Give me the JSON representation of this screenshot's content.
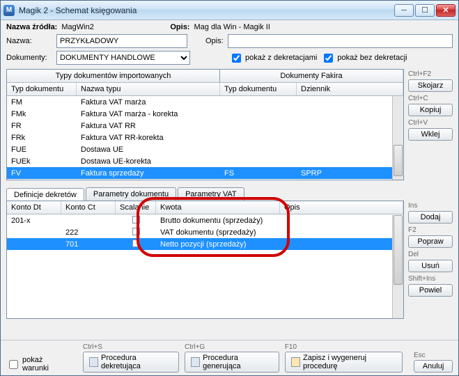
{
  "window": {
    "title": "Magik 2 - Schemat księgowania"
  },
  "header": {
    "source_label": "Nazwa źródła:",
    "source_value": "MagWin2",
    "desc_label": "Opis:",
    "desc_value": "Mag dla Win - Magik II"
  },
  "form": {
    "name_label": "Nazwa:",
    "name_value": "PRZYKŁADOWY",
    "desc_label": "Opis:",
    "desc_value": "",
    "docs_label": "Dokumenty:",
    "docs_value": "DOKUMENTY HANDLOWE",
    "show_with": "pokaż z dekretacjami",
    "show_without": "pokaż bez dekretacji"
  },
  "imported": {
    "section_title": "Typy dokumentów importowanych",
    "col_doc": "Typ dokumentu",
    "col_name": "Nazwa typu",
    "rows": [
      {
        "doc": "FM",
        "name": "Faktura VAT marża"
      },
      {
        "doc": "FMk",
        "name": "Faktura VAT marża - korekta"
      },
      {
        "doc": "FR",
        "name": "Faktura VAT RR"
      },
      {
        "doc": "FRk",
        "name": "Faktura VAT RR-korekta"
      },
      {
        "doc": "FUE",
        "name": "Dostawa UE"
      },
      {
        "doc": "FUEk",
        "name": "Dostawa UE-korekta"
      },
      {
        "doc": "FV",
        "name": "Faktura sprzedaży"
      }
    ]
  },
  "fakir": {
    "section_title": "Dokumenty Fakira",
    "col_doc": "Typ dokumentu",
    "col_journal": "Dziennik",
    "selected_doc": "FS",
    "selected_journal": "SPRP"
  },
  "side1": {
    "hint1": "Ctrl+F2",
    "btn1": "Skojarz",
    "hint2": "Ctrl+C",
    "btn2": "Kopiuj",
    "hint3": "Ctrl+V",
    "btn3": "Wklej"
  },
  "tabs": [
    "Definicje dekretów",
    "Parametry dokumentu",
    "Parametry VAT"
  ],
  "dekret": {
    "cols": [
      "Konto Dt",
      "Konto Ct",
      "Scalanie",
      "Kwota",
      "Opis"
    ],
    "rows": [
      {
        "dt": "201-x",
        "ct": "",
        "sc": "",
        "kw": "Brutto dokumentu (sprzedaży)",
        "op": ""
      },
      {
        "dt": "",
        "ct": "222",
        "sc": "",
        "kw": "VAT dokumentu (sprzedaży)",
        "op": ""
      },
      {
        "dt": "",
        "ct": "701",
        "sc": "",
        "kw": "Netto pozycji (sprzedaży)",
        "op": ""
      }
    ]
  },
  "side2": {
    "h1": "Ins",
    "b1": "Dodaj",
    "h2": "F2",
    "b2": "Popraw",
    "h3": "Del",
    "b3": "Usuń",
    "h4": "Shift+Ins",
    "b4": "Powiel"
  },
  "footer": {
    "show_cond": "pokaż warunki",
    "h1": "Ctrl+S",
    "b1": "Procedura dekretująca",
    "h2": "Ctrl+G",
    "b2": "Procedura generująca",
    "h3": "F10",
    "b3": "Zapisz i wygeneruj procedurę",
    "h4": "Esc",
    "b4": "Anuluj"
  }
}
